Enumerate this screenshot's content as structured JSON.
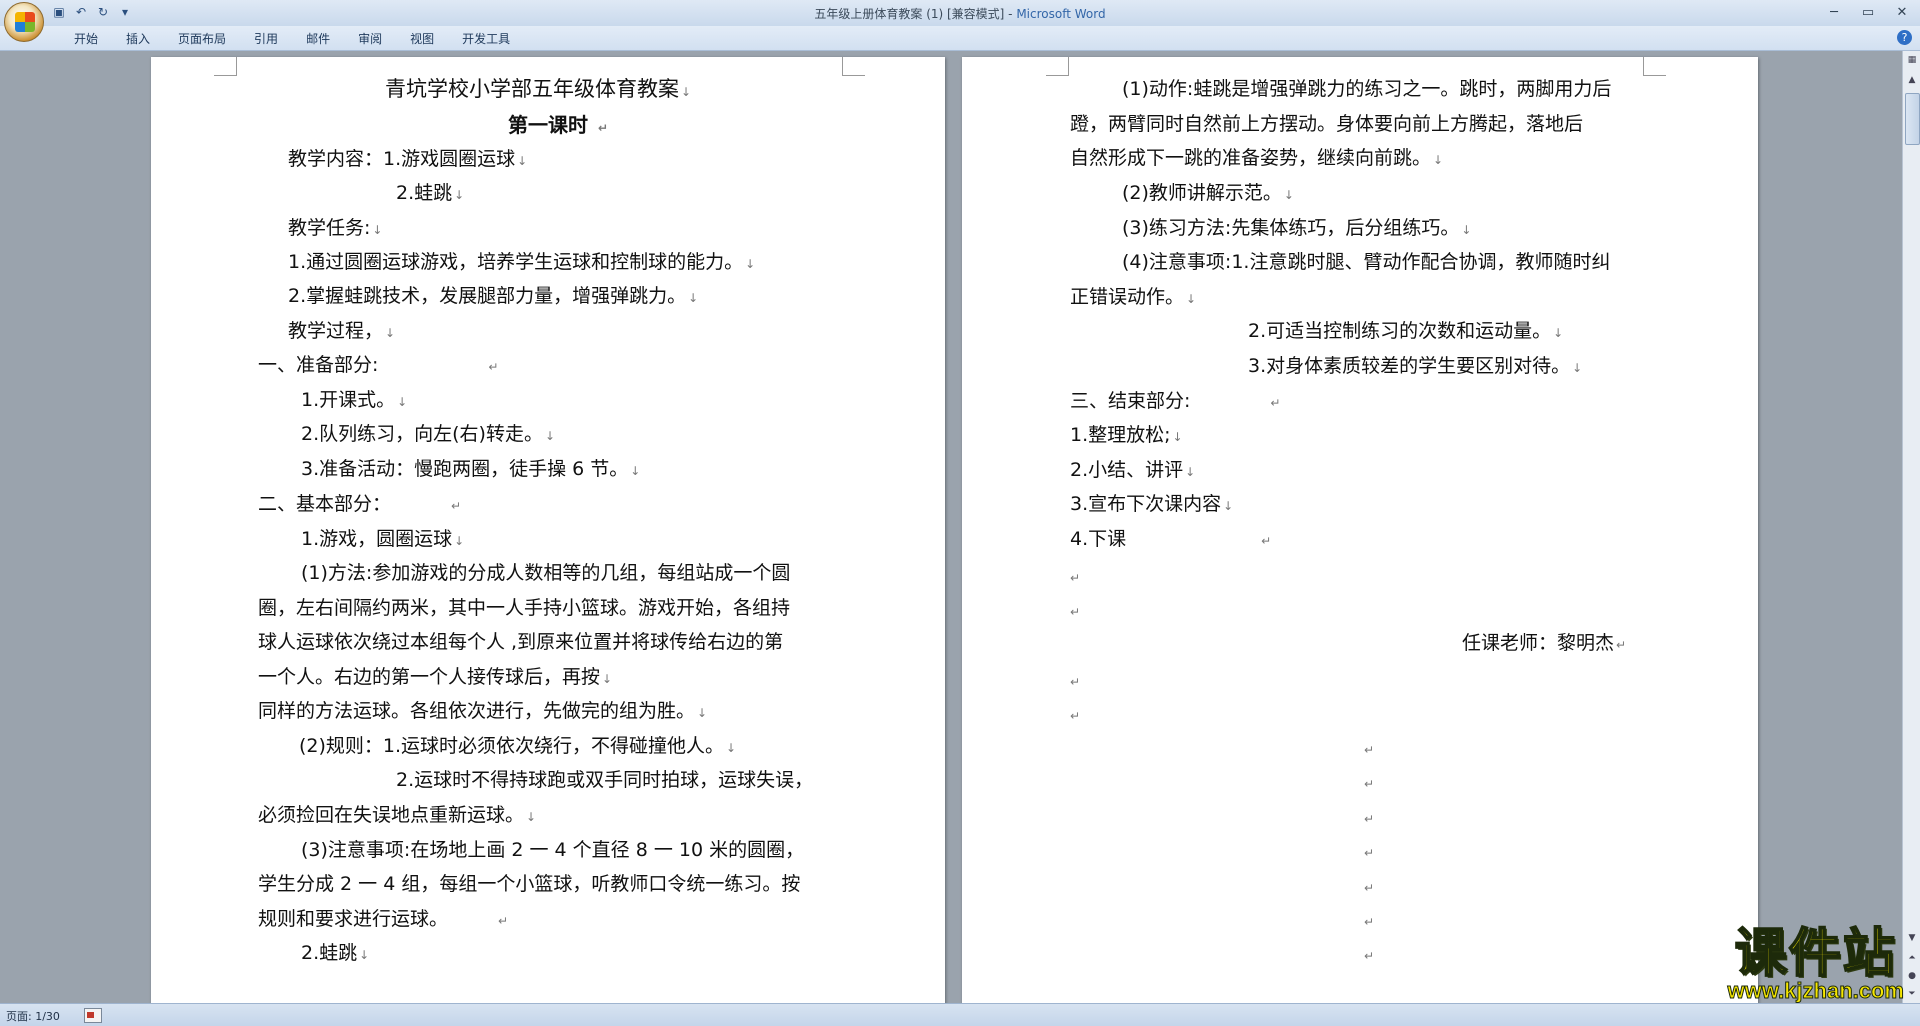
{
  "window": {
    "doc_title": "五年级上册体育教案 (1) [兼容模式] - ",
    "app_name": "Microsoft Word"
  },
  "ribbon": {
    "tabs": [
      "开始",
      "插入",
      "页面布局",
      "引用",
      "邮件",
      "审阅",
      "视图",
      "开发工具"
    ]
  },
  "page_left": {
    "lines": [
      "青坑学校小学部五年级体育教案",
      "第一课时",
      "教学内容：1.游戏圆圈运球",
      "2.蛙跳",
      "教学任务:",
      "1.通过圆圈运球游戏，培养学生运球和控制球的能力。",
      "2.掌握蛙跳技术，发展腿部力量，增强弹跳力。",
      "教学过程，",
      "一、准备部分:",
      "1.开课式。",
      "2.队列练习，向左(右)转走。",
      "3.准备活动：慢跑两圈，徒手操 6 节。",
      "二、基本部分：",
      "1.游戏，圆圈运球",
      "(1)方法:参加游戏的分成人数相等的几组，每组站成一个圆",
      "圈，左右间隔约两米，其中一人手持小篮球。游戏开始，各组持",
      "球人运球依次绕过本组每个人 ,到原来位置并将球传给右边的第",
      "一个人。右边的第一个人接传球后，再按",
      "同样的方法运球。各组依次进行，先做完的组为胜。",
      "(2)规则：1.运球时必须依次绕行，不得碰撞他人。",
      "2.运球时不得持球跑或双手同时拍球，运球失误，",
      "必须捡回在失误地点重新运球。",
      "(3)注意事项:在场地上画 2 一 4 个直径 8 一 10 米的圆圈，",
      "学生分成 2 一 4 组，每组一个小篮球，听教师口令统一练习。按",
      "规则和要求进行运球。",
      "2.蛙跳"
    ]
  },
  "page_right": {
    "lines": [
      "(1)动作:蛙跳是增强弹跳力的练习之一。跳时，两脚用力后",
      "蹬，两臂同时自然前上方摆动。身体要向前上方腾起，落地后",
      "自然形成下一跳的准备姿势，继续向前跳。",
      "(2)教师讲解示范。",
      "(3)练习方法:先集体练巧，后分组练巧。",
      "(4)注意事项:1.注意跳时腿、臂动作配合协调，教师随时纠",
      "正错误动作。",
      "2.可适当控制练习的次数和运动量。",
      "3.对身体素质较差的学生要区别对待。",
      "三、结束部分:",
      "1.整理放松;",
      "2.小结、讲评",
      "3.宣布下次课内容",
      "4.下课",
      "任课老师：黎明杰"
    ]
  },
  "marks": {
    "para": "↵",
    "arrow": "↓"
  },
  "status": {
    "page": "页面: 1/30"
  },
  "watermark": {
    "cn": "课件站",
    "url": "www.kjzhan.com"
  }
}
